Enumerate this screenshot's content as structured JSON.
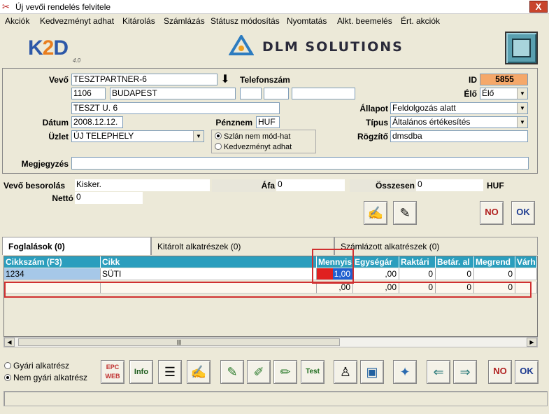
{
  "window": {
    "title": "Új vevői rendelés felvitele",
    "close_glyph": "X"
  },
  "menu": [
    "Akciók",
    "Kedvezményt adhat",
    "Kitárolás",
    "Számlázás",
    "Státusz módosítás",
    "Nyomtatás",
    "Alkt. beemelés",
    "Ért. akciók"
  ],
  "logos": {
    "k2d_k": "K",
    "k2d_two": "2",
    "k2d_d": "D",
    "k2d_version": "4.0",
    "brand": "DLM SOLUTIONS"
  },
  "form": {
    "vevo_label": "Vevő",
    "vevo": "TESZTPARTNER-6",
    "zip": "1106",
    "city": "BUDAPEST",
    "street": "TESZT U. 6",
    "telefon_label": "Telefonszám",
    "id_label": "ID",
    "id": "5855",
    "elo_label": "Élő",
    "elo": "Élő",
    "datum_label": "Dátum",
    "datum": "2008.12.12.",
    "penznem_label": "Pénznem",
    "penznem": "HUF",
    "allapot_label": "Állapot",
    "allapot": "Feldolgozás alatt",
    "uzlet_label": "Üzlet",
    "uzlet": "ÚJ TELEPHELY",
    "tipus_label": "Típus",
    "tipus": "Általános értékesítés",
    "radio1": "Szlán nem mód-hat",
    "radio2": "Kedvezményt adhat",
    "rogzito_label": "Rögzítő",
    "rogzito": "dmsdba",
    "megjegyzes_label": "Megjegyzés",
    "megjegyzes": ""
  },
  "summary": {
    "besorolas_label": "Vevő besorolás",
    "besorolas": "Kisker.",
    "afa_label": "Áfa",
    "afa": "0",
    "osszesen_label": "Összesen",
    "osszesen": "0",
    "currency": "HUF",
    "netto_label": "Nettó",
    "netto": "0"
  },
  "tabs": [
    "Foglalások (0)",
    "Kitárolt alkatrészek (0)",
    "Számlázott alkatrészek (0)"
  ],
  "grid": {
    "headers": [
      "Cikkszám (F3)",
      "Cikk",
      "Mennyis",
      "Egységár",
      "Raktári",
      "Betár. al",
      "Megrend",
      "Várh"
    ],
    "rows": [
      [
        "1234",
        "SÜTI",
        "1,00",
        ",00",
        "0",
        "0",
        "0",
        ""
      ],
      [
        "",
        "",
        ",00",
        ",00",
        "0",
        "0",
        "0",
        ""
      ]
    ]
  },
  "bottom": {
    "radio_gyari": "Gyári alkatrész",
    "radio_nem_gyari": "Nem gyári alkatrész"
  },
  "icons": {
    "ok_text": "OK",
    "no_text": "NO",
    "epc": "EPC",
    "web": "WEB",
    "info": "Info",
    "test": "Test"
  },
  "colors": {
    "accent": "#2b9ebd",
    "id_bg": "#f5a86a",
    "highlight": "#d03030"
  }
}
